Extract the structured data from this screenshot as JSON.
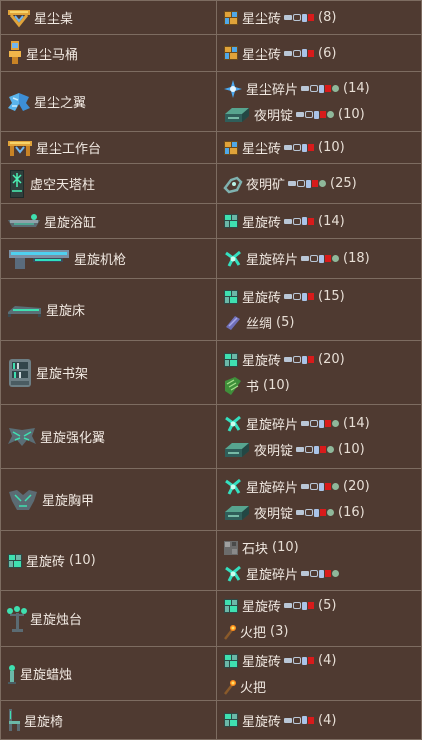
{
  "station_colors": {
    "pc": "#b9c6d6",
    "console": "#b9c6d6",
    "mobile": "#a9c3e8",
    "3ds": "#d81b1b",
    "old_gen": "#8fb89a"
  },
  "rows": [
    {
      "name": "星尘桌",
      "icon": "stardust-table-icon",
      "h": 34,
      "ingredients": [
        {
          "name": "星尘砖",
          "count": "(8)",
          "icon": "stardust-brick-icon",
          "stations": "3ds"
        }
      ]
    },
    {
      "name": "星尘马桶",
      "icon": "stardust-toilet-icon",
      "h": 37,
      "ingredients": [
        {
          "name": "星尘砖",
          "count": "(6)",
          "icon": "stardust-brick-icon",
          "stations": "3ds"
        }
      ]
    },
    {
      "name": "星尘之翼",
      "icon": "stardust-wings-icon",
      "h": 60,
      "ingredients": [
        {
          "name": "星尘碎片",
          "count": "(14)",
          "icon": "stardust-fragment-icon",
          "stations": "oldgen"
        },
        {
          "name": "夜明锭",
          "count": "(10)",
          "icon": "luminite-bar-icon",
          "stations": "oldgen"
        }
      ]
    },
    {
      "name": "星尘工作台",
      "icon": "stardust-work-bench-icon",
      "h": 32,
      "ingredients": [
        {
          "name": "星尘砖",
          "count": "(10)",
          "icon": "stardust-brick-icon",
          "stations": "3ds"
        }
      ]
    },
    {
      "name": "虚空天塔柱",
      "icon": "celestial-monolith-icon",
      "h": 40,
      "ingredients": [
        {
          "name": "夜明矿",
          "count": "(25)",
          "icon": "luminite-ore-icon",
          "stations": "oldgen"
        }
      ]
    },
    {
      "name": "星旋浴缸",
      "icon": "vortex-bathtub-icon",
      "h": 35,
      "ingredients": [
        {
          "name": "星旋砖",
          "count": "(14)",
          "icon": "vortex-brick-icon",
          "stations": "3ds"
        }
      ]
    },
    {
      "name": "星旋机枪",
      "icon": "vortex-beater-icon",
      "h": 40,
      "ingredients": [
        {
          "name": "星旋碎片",
          "count": "(18)",
          "icon": "vortex-fragment-icon",
          "stations": "oldgen"
        }
      ]
    },
    {
      "name": "星旋床",
      "icon": "vortex-bed-icon",
      "h": 62,
      "ingredients": [
        {
          "name": "星旋砖",
          "count": "(15)",
          "icon": "vortex-brick-icon",
          "stations": "3ds"
        },
        {
          "name": "丝绸",
          "count": "(5)",
          "icon": "silk-icon",
          "stations": ""
        }
      ]
    },
    {
      "name": "星旋书架",
      "icon": "vortex-bookcase-icon",
      "h": 64,
      "ingredients": [
        {
          "name": "星旋砖",
          "count": "(20)",
          "icon": "vortex-brick-icon",
          "stations": "3ds"
        },
        {
          "name": "书",
          "count": "(10)",
          "icon": "book-icon",
          "stations": ""
        }
      ]
    },
    {
      "name": "星旋强化翼",
      "icon": "vortex-booster-icon",
      "h": 64,
      "ingredients": [
        {
          "name": "星旋碎片",
          "count": "(14)",
          "icon": "vortex-fragment-icon",
          "stations": "oldgen"
        },
        {
          "name": "夜明锭",
          "count": "(10)",
          "icon": "luminite-bar-icon",
          "stations": "oldgen"
        }
      ]
    },
    {
      "name": "星旋胸甲",
      "icon": "vortex-breastplate-icon",
      "h": 62,
      "ingredients": [
        {
          "name": "星旋碎片",
          "count": "(20)",
          "icon": "vortex-fragment-icon",
          "stations": "oldgen"
        },
        {
          "name": "夜明锭",
          "count": "(16)",
          "icon": "luminite-bar-icon",
          "stations": "oldgen"
        }
      ]
    },
    {
      "name": "星旋砖",
      "count": "(10)",
      "icon": "vortex-brick-icon",
      "h": 60,
      "ingredients": [
        {
          "name": "石块",
          "count": "(10)",
          "icon": "stone-block-icon",
          "stations": ""
        },
        {
          "name": "星旋碎片",
          "count": "",
          "icon": "vortex-fragment-icon",
          "stations": "oldgen"
        }
      ]
    },
    {
      "name": "星旋烛台",
      "icon": "vortex-candelabra-icon",
      "h": 56,
      "ingredients": [
        {
          "name": "星旋砖",
          "count": "(5)",
          "icon": "vortex-brick-icon",
          "stations": "3ds"
        },
        {
          "name": "火把",
          "count": "(3)",
          "icon": "torch-icon",
          "stations": ""
        }
      ]
    },
    {
      "name": "星旋蜡烛",
      "icon": "vortex-candle-icon",
      "h": 54,
      "ingredients": [
        {
          "name": "星旋砖",
          "count": "(4)",
          "icon": "vortex-brick-icon",
          "stations": "3ds"
        },
        {
          "name": "火把",
          "count": "",
          "icon": "torch-icon",
          "stations": ""
        }
      ]
    },
    {
      "name": "星旋椅",
      "icon": "vortex-chair-icon",
      "h": 39,
      "ingredients": [
        {
          "name": "星旋砖",
          "count": "(4)",
          "icon": "vortex-brick-icon",
          "stations": "3ds"
        }
      ]
    }
  ]
}
